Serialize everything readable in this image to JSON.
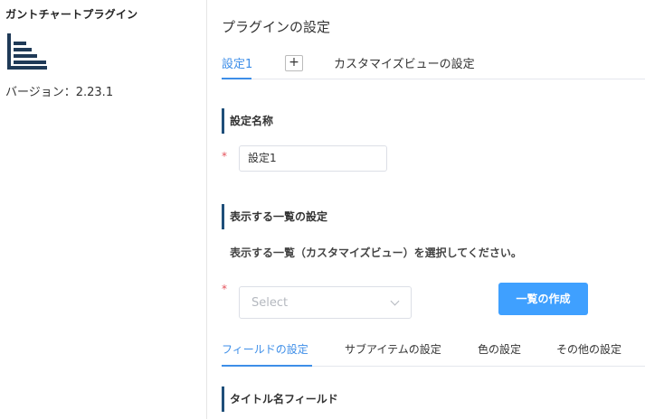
{
  "sidebar": {
    "plugin_name": "ガントチャートプラグイン",
    "logo_icon": "gantt-chart-icon",
    "version_label": "バージョン：2.23.1"
  },
  "main": {
    "page_title": "プラグインの設定",
    "top_tabs": [
      {
        "label": "設定1",
        "active": true
      },
      {
        "label": "カスタマイズビューの設定",
        "active": false
      }
    ],
    "add_tab_label": "+",
    "sections": {
      "setting_name": {
        "heading": "設定名称",
        "required_mark": "*",
        "value": "設定1"
      },
      "list_settings": {
        "heading": "表示する一覧の設定",
        "instruction": "表示する一覧（カスタマイズビュー）を選択してください。",
        "required_mark": "*",
        "select_placeholder": "Select",
        "create_button": "一覧の作成"
      },
      "title_field": {
        "heading": "タイトル名フィールド"
      }
    },
    "sub_tabs": [
      {
        "label": "フィールドの設定",
        "active": true
      },
      {
        "label": "サブアイテムの設定",
        "active": false
      },
      {
        "label": "色の設定",
        "active": false
      },
      {
        "label": "その他の設定",
        "active": false
      }
    ]
  },
  "colors": {
    "accent": "#3d8ee8",
    "button": "#3fa0ff",
    "heading_bar": "#1f4f7a",
    "required": "#e4525b",
    "logo": "#1f3a57"
  }
}
